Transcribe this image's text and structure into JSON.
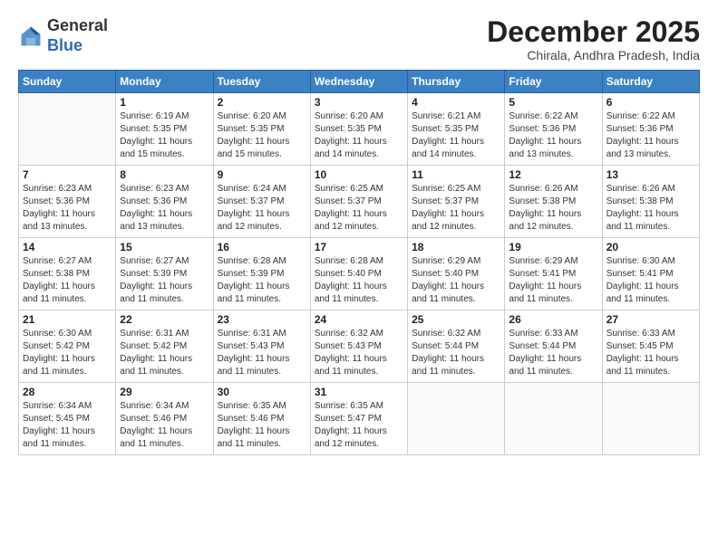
{
  "logo": {
    "general": "General",
    "blue": "Blue"
  },
  "header": {
    "title": "December 2025",
    "location": "Chirala, Andhra Pradesh, India"
  },
  "weekdays": [
    "Sunday",
    "Monday",
    "Tuesday",
    "Wednesday",
    "Thursday",
    "Friday",
    "Saturday"
  ],
  "weeks": [
    [
      {
        "day": "",
        "info": ""
      },
      {
        "day": "1",
        "info": "Sunrise: 6:19 AM\nSunset: 5:35 PM\nDaylight: 11 hours\nand 15 minutes."
      },
      {
        "day": "2",
        "info": "Sunrise: 6:20 AM\nSunset: 5:35 PM\nDaylight: 11 hours\nand 15 minutes."
      },
      {
        "day": "3",
        "info": "Sunrise: 6:20 AM\nSunset: 5:35 PM\nDaylight: 11 hours\nand 14 minutes."
      },
      {
        "day": "4",
        "info": "Sunrise: 6:21 AM\nSunset: 5:35 PM\nDaylight: 11 hours\nand 14 minutes."
      },
      {
        "day": "5",
        "info": "Sunrise: 6:22 AM\nSunset: 5:36 PM\nDaylight: 11 hours\nand 13 minutes."
      },
      {
        "day": "6",
        "info": "Sunrise: 6:22 AM\nSunset: 5:36 PM\nDaylight: 11 hours\nand 13 minutes."
      }
    ],
    [
      {
        "day": "7",
        "info": "Sunrise: 6:23 AM\nSunset: 5:36 PM\nDaylight: 11 hours\nand 13 minutes."
      },
      {
        "day": "8",
        "info": "Sunrise: 6:23 AM\nSunset: 5:36 PM\nDaylight: 11 hours\nand 13 minutes."
      },
      {
        "day": "9",
        "info": "Sunrise: 6:24 AM\nSunset: 5:37 PM\nDaylight: 11 hours\nand 12 minutes."
      },
      {
        "day": "10",
        "info": "Sunrise: 6:25 AM\nSunset: 5:37 PM\nDaylight: 11 hours\nand 12 minutes."
      },
      {
        "day": "11",
        "info": "Sunrise: 6:25 AM\nSunset: 5:37 PM\nDaylight: 11 hours\nand 12 minutes."
      },
      {
        "day": "12",
        "info": "Sunrise: 6:26 AM\nSunset: 5:38 PM\nDaylight: 11 hours\nand 12 minutes."
      },
      {
        "day": "13",
        "info": "Sunrise: 6:26 AM\nSunset: 5:38 PM\nDaylight: 11 hours\nand 11 minutes."
      }
    ],
    [
      {
        "day": "14",
        "info": "Sunrise: 6:27 AM\nSunset: 5:38 PM\nDaylight: 11 hours\nand 11 minutes."
      },
      {
        "day": "15",
        "info": "Sunrise: 6:27 AM\nSunset: 5:39 PM\nDaylight: 11 hours\nand 11 minutes."
      },
      {
        "day": "16",
        "info": "Sunrise: 6:28 AM\nSunset: 5:39 PM\nDaylight: 11 hours\nand 11 minutes."
      },
      {
        "day": "17",
        "info": "Sunrise: 6:28 AM\nSunset: 5:40 PM\nDaylight: 11 hours\nand 11 minutes."
      },
      {
        "day": "18",
        "info": "Sunrise: 6:29 AM\nSunset: 5:40 PM\nDaylight: 11 hours\nand 11 minutes."
      },
      {
        "day": "19",
        "info": "Sunrise: 6:29 AM\nSunset: 5:41 PM\nDaylight: 11 hours\nand 11 minutes."
      },
      {
        "day": "20",
        "info": "Sunrise: 6:30 AM\nSunset: 5:41 PM\nDaylight: 11 hours\nand 11 minutes."
      }
    ],
    [
      {
        "day": "21",
        "info": "Sunrise: 6:30 AM\nSunset: 5:42 PM\nDaylight: 11 hours\nand 11 minutes."
      },
      {
        "day": "22",
        "info": "Sunrise: 6:31 AM\nSunset: 5:42 PM\nDaylight: 11 hours\nand 11 minutes."
      },
      {
        "day": "23",
        "info": "Sunrise: 6:31 AM\nSunset: 5:43 PM\nDaylight: 11 hours\nand 11 minutes."
      },
      {
        "day": "24",
        "info": "Sunrise: 6:32 AM\nSunset: 5:43 PM\nDaylight: 11 hours\nand 11 minutes."
      },
      {
        "day": "25",
        "info": "Sunrise: 6:32 AM\nSunset: 5:44 PM\nDaylight: 11 hours\nand 11 minutes."
      },
      {
        "day": "26",
        "info": "Sunrise: 6:33 AM\nSunset: 5:44 PM\nDaylight: 11 hours\nand 11 minutes."
      },
      {
        "day": "27",
        "info": "Sunrise: 6:33 AM\nSunset: 5:45 PM\nDaylight: 11 hours\nand 11 minutes."
      }
    ],
    [
      {
        "day": "28",
        "info": "Sunrise: 6:34 AM\nSunset: 5:45 PM\nDaylight: 11 hours\nand 11 minutes."
      },
      {
        "day": "29",
        "info": "Sunrise: 6:34 AM\nSunset: 5:46 PM\nDaylight: 11 hours\nand 11 minutes."
      },
      {
        "day": "30",
        "info": "Sunrise: 6:35 AM\nSunset: 5:46 PM\nDaylight: 11 hours\nand 11 minutes."
      },
      {
        "day": "31",
        "info": "Sunrise: 6:35 AM\nSunset: 5:47 PM\nDaylight: 11 hours\nand 12 minutes."
      },
      {
        "day": "",
        "info": ""
      },
      {
        "day": "",
        "info": ""
      },
      {
        "day": "",
        "info": ""
      }
    ]
  ]
}
